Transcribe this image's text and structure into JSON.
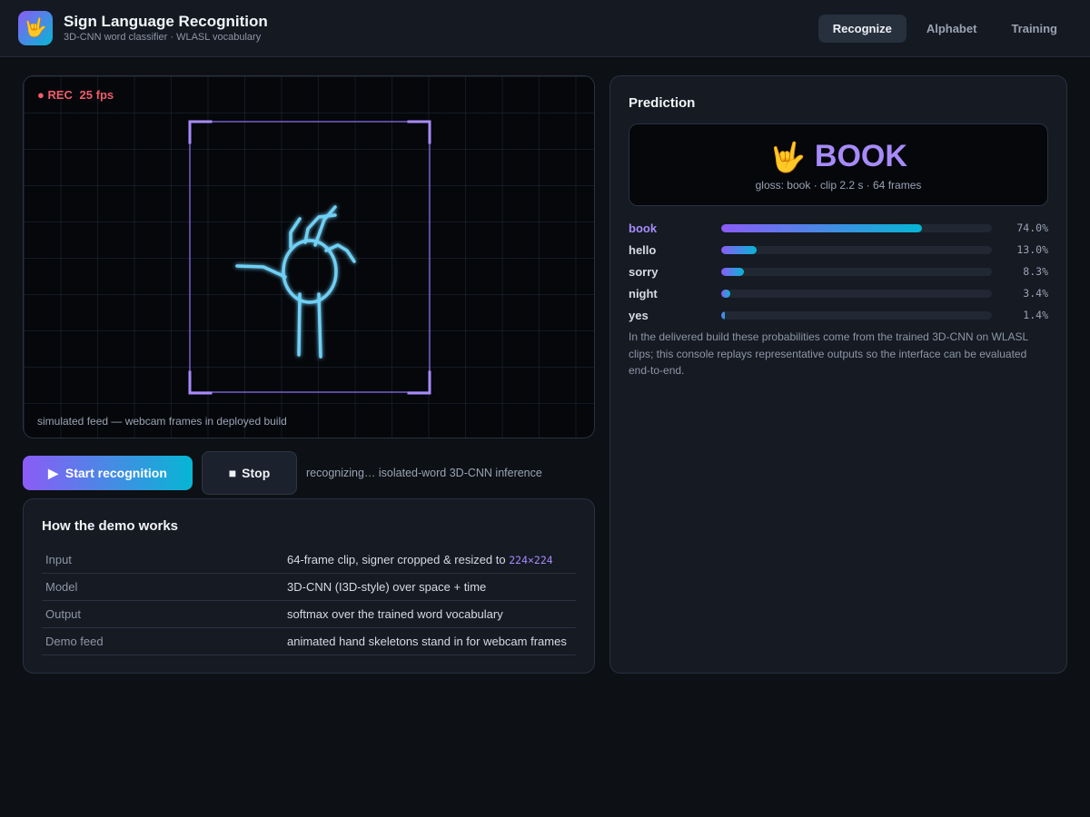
{
  "app": {
    "logo_emoji": "🤟",
    "title": "Sign Language Recognition",
    "subtitle": "3D-CNN word classifier · WLASL vocabulary"
  },
  "nav": {
    "tabs": [
      {
        "label": "Recognize",
        "active": true
      },
      {
        "label": "Alphabet",
        "active": false
      },
      {
        "label": "Training",
        "active": false
      }
    ]
  },
  "video": {
    "rec_label": "● REC",
    "fps": "25 fps",
    "caption": "simulated feed — webcam frames in deployed build"
  },
  "controls": {
    "start_icon": "▶",
    "start_label": "Start recognition",
    "stop_icon": "■",
    "stop_label": "Stop",
    "status": "recognizing… isolated-word 3D-CNN inference"
  },
  "how": {
    "title": "How the demo works",
    "rows": [
      {
        "key": "Input",
        "value": "64-frame clip, signer cropped & resized to ",
        "code": "224×224"
      },
      {
        "key": "Model",
        "value": "3D-CNN (I3D-style) over space + time",
        "code": ""
      },
      {
        "key": "Output",
        "value": "softmax over the trained word vocabulary",
        "code": ""
      },
      {
        "key": "Demo feed",
        "value": "animated hand skeletons stand in for webcam frames",
        "code": ""
      }
    ]
  },
  "prediction": {
    "title": "Prediction",
    "emoji": "🤟",
    "word": "BOOK",
    "meta": "gloss: book · clip 2.2 s · 64 frames",
    "scores": [
      {
        "label": "book",
        "value": 0.74,
        "pct": "74.0%"
      },
      {
        "label": "hello",
        "value": 0.13,
        "pct": "13.0%"
      },
      {
        "label": "sorry",
        "value": 0.083,
        "pct": "8.3%"
      },
      {
        "label": "night",
        "value": 0.034,
        "pct": "3.4%"
      },
      {
        "label": "yes",
        "value": 0.014,
        "pct": "1.4%"
      }
    ],
    "note": "In the delivered build these probabilities come from the trained 3D-CNN on WLASL clips; this console replays representative outputs so the interface can be evaluated end-to-end."
  },
  "colors": {
    "accent_violet": "#8b5cf6",
    "accent_cyan": "#06b6d4",
    "rec_red": "#f05d6c",
    "skeleton": "#6fd0f5",
    "bbox": "#a78bfa"
  }
}
